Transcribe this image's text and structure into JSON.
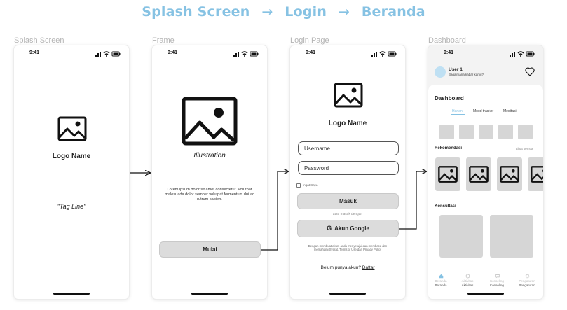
{
  "flow": {
    "step1": "Splash Screen",
    "step2": "Login",
    "step3": "Beranda",
    "arrow": "→"
  },
  "labels": {
    "splash": "Splash Screen",
    "frame": "Frame",
    "login": "Login Page",
    "dashboard": "Dashboard"
  },
  "status": {
    "time": "9:41"
  },
  "splash": {
    "logo_name": "Logo Name",
    "tag_line": "\"Tag Line\""
  },
  "onboarding": {
    "illustration": "Illustration",
    "body": "Lorem ipsum dolor sit amet consectetur. Volutpat malesuada dolor semper volutpat fermentum dui ac rutrum sapien.",
    "start_button": "Mulai"
  },
  "login": {
    "logo_name": "Logo Name",
    "username_placeholder": "Username",
    "password_placeholder": "Password",
    "remember_label": "Ingat Saya",
    "login_button": "Masuk",
    "or_text": "atau masuk dengan",
    "google_button": "Akun Google",
    "terms_text": "Dengan membuat akun, anda menyetujui dan membaca dan memahami Syarat, Terms of Use dan Privacy Policy",
    "register_prompt": "Belum punya akun?",
    "register_link": "Daftar"
  },
  "dashboard": {
    "user_name": "User 1",
    "greeting": "Bagaimana kabar kamu?",
    "title": "Dashboard",
    "tabs": [
      "Harian",
      "Mood tracker",
      "Meditasi"
    ],
    "recommendation_title": "Rekomendasi",
    "see_all": "Lihat semua",
    "consult_title": "Konsultasi",
    "nav": [
      {
        "sub": "Beranda",
        "label": "Beranda"
      },
      {
        "sub": "Aktivitas",
        "label": "Aktivitas"
      },
      {
        "sub": "Konseling",
        "label": "Konseling"
      },
      {
        "sub": "Pengaturan",
        "label": "Pengaturan"
      }
    ]
  },
  "colors": {
    "title_blue": "#86c2e3",
    "gray_fill": "#d6d6d6",
    "button_gray": "#dcdcdc",
    "avatar_blue": "#bfe0f3"
  },
  "icons": [
    "image-placeholder-icon",
    "google-icon",
    "heart-icon",
    "signal-icon",
    "wifi-icon",
    "battery-icon"
  ]
}
